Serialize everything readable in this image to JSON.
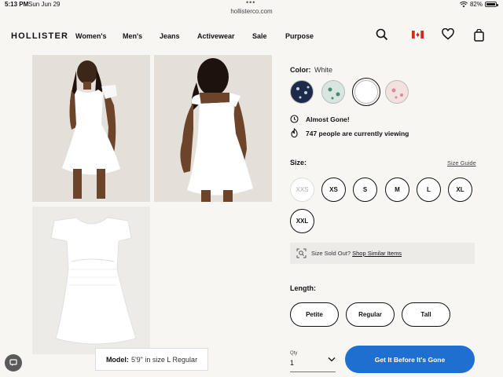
{
  "status_bar": {
    "time": "5:13 PM",
    "date": "Sun Jun 29",
    "url": "hollisterco.com",
    "battery": "82%",
    "battery_level": 0.82
  },
  "nav": {
    "logo": "HOLLISTER",
    "links": [
      "Women's",
      "Men's",
      "Jeans",
      "Activewear",
      "Sale",
      "Purpose"
    ],
    "icons": [
      "search-icon",
      "canada-flag-icon",
      "heart-icon",
      "shopping-bag-icon"
    ]
  },
  "gallery": {
    "model_label": "Model:",
    "model_info": "5'9\" in size L Regular"
  },
  "color": {
    "label": "Color:",
    "selected": "White",
    "swatches": [
      {
        "name": "navy-floral",
        "color": "#1e2a4a",
        "dot": "#c9d2e6"
      },
      {
        "name": "green-floral",
        "color": "#d7e6df",
        "dot": "#4b8a72"
      },
      {
        "name": "white",
        "color": "#ffffff",
        "dot": "#ffffff"
      },
      {
        "name": "pink-floral",
        "color": "#f3e1e0",
        "dot": "#d08f92"
      }
    ]
  },
  "stock": {
    "almost_gone": "Almost Gone!",
    "viewing": "747 people are currently viewing"
  },
  "size": {
    "label": "Size:",
    "guide": "Size Guide",
    "options": [
      "XXS",
      "XS",
      "S",
      "M",
      "L",
      "XL",
      "XXL"
    ],
    "sold_out_prompt": "Size Sold Out?",
    "sold_out_link": "Shop Similar Items"
  },
  "length": {
    "label": "Length:",
    "options": [
      "Petite",
      "Regular",
      "Tall"
    ]
  },
  "quantity": {
    "label": "Qty",
    "value": "1"
  },
  "cta": {
    "label": "Get It Before It's Gone",
    "color": "#1f6fd1"
  }
}
